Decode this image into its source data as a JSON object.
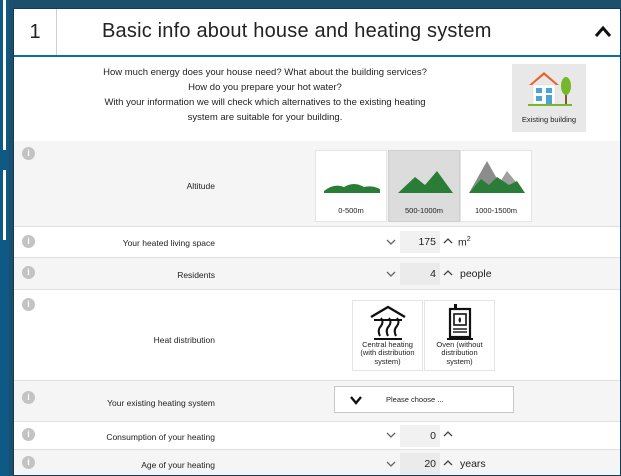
{
  "section": {
    "number": "1",
    "title": "Basic info about house and heating system"
  },
  "intro": {
    "lines": [
      "How much energy does your house need? What about the building services?",
      "How do you prepare your hot water?",
      "With your information we will check which alternatives to the existing heating",
      "system are suitable for your building."
    ],
    "building_option": "Existing building"
  },
  "fields": {
    "altitude": {
      "label": "Altitude",
      "options": [
        "0-500m",
        "500-1000m",
        "1000-1500m"
      ],
      "selected": "500-1000m"
    },
    "living_space": {
      "label": "Your heated living space",
      "value": "175",
      "unit": "m",
      "unit_sup": "2"
    },
    "residents": {
      "label": "Residents",
      "value": "4",
      "unit": "people"
    },
    "heat_distribution": {
      "label": "Heat distribution",
      "options": [
        {
          "lines": [
            "Central heating",
            "(with distribution",
            "system)"
          ],
          "icon": "central-heating-icon"
        },
        {
          "lines": [
            "Oven (without",
            "distribution",
            "system)"
          ],
          "icon": "oven-icon"
        }
      ]
    },
    "existing_heating": {
      "label": "Your existing heating system",
      "placeholder": "Please choose ..."
    },
    "consumption": {
      "label": "Consumption of your heating",
      "value": "0",
      "unit": ""
    },
    "age": {
      "label": "Age of your heating",
      "value": "20",
      "unit": "years"
    }
  },
  "colors": {
    "accent": "#0e6ea6",
    "mountain_green": "#2a7d37",
    "mountain_grey": "#8c8c8c",
    "info_icon": "#c3c3c3"
  }
}
